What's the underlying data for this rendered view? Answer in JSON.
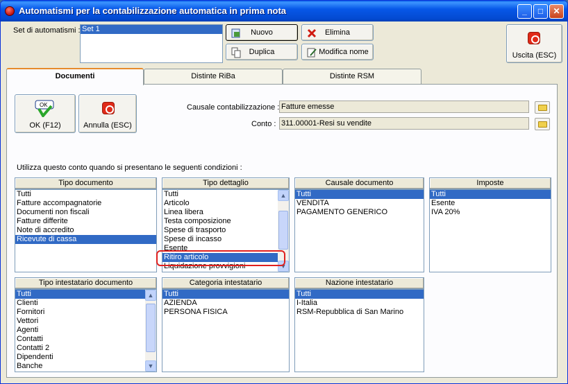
{
  "window": {
    "title": "Automatismi per la contabilizzazione automatica in prima nota",
    "minimize": "_",
    "maximize": "□",
    "close": "✕"
  },
  "set": {
    "label": "Set di automatismi :",
    "items": [
      "Set 1"
    ],
    "selected": "Set 1"
  },
  "toolbar": {
    "nuovo": "Nuovo",
    "elimina": "Elimina",
    "duplica": "Duplica",
    "modifica_nome": "Modifica nome",
    "uscita": "Uscita (ESC)"
  },
  "tabs": [
    {
      "label": "Documenti",
      "active": true
    },
    {
      "label": "Distinte RiBa",
      "active": false
    },
    {
      "label": "Distinte RSM",
      "active": false
    }
  ],
  "actions": {
    "ok": "OK (F12)",
    "annulla": "Annulla (ESC)",
    "ok_icon_text": "OK"
  },
  "fields": {
    "causale_label": "Causale contabilizzazione :",
    "causale_value": "Fatture emesse",
    "conto_label": "Conto :",
    "conto_value": "311.00001-Resi su vendite"
  },
  "conditions_label": "Utilizza questo conto quando si presentano le seguenti condizioni :",
  "groups": {
    "tipo_documento": {
      "header": "Tipo documento",
      "items": [
        "Tutti",
        "Fatture accompagnatorie",
        "Documenti non fiscali",
        "Fatture differite",
        "Note di accredito",
        "Ricevute di cassa"
      ],
      "selected_index": 5
    },
    "tipo_dettaglio": {
      "header": "Tipo dettaglio",
      "items": [
        "Tutti",
        "Articolo",
        "Linea libera",
        "Testa composizione",
        "Spese di trasporto",
        "Spese di incasso",
        "Esente",
        "Ritiro articolo",
        "Liquidazione provvigioni"
      ],
      "selected_index": 7
    },
    "causale_documento": {
      "header": "Causale documento",
      "items": [
        "Tutti",
        "VENDITA",
        "PAGAMENTO GENERICO"
      ],
      "selected_index": 0
    },
    "imposte": {
      "header": "Imposte",
      "items": [
        "Tutti",
        "Esente",
        "IVA 20%"
      ],
      "selected_index": 0
    },
    "tipo_intestatario": {
      "header": "Tipo intestatario documento",
      "items": [
        "Tutti",
        "Clienti",
        "Fornitori",
        "Vettori",
        "Agenti",
        "Contatti",
        "Contatti 2",
        "Dipendenti",
        "Banche"
      ],
      "selected_index": 0
    },
    "categoria_intestatario": {
      "header": "Categoria intestatario",
      "items": [
        "Tutti",
        "AZIENDA",
        "PERSONA FISICA"
      ],
      "selected_index": 0
    },
    "nazione_intestatario": {
      "header": "Nazione intestatario",
      "items": [
        "Tutti",
        "I-Italia",
        "RSM-Repubblica di San Marino"
      ],
      "selected_index": 0
    }
  },
  "scroll_arrows": {
    "up": "▲",
    "down": "▼"
  },
  "colors": {
    "selection": "#316ac5",
    "highlight_ring": "#e0201e",
    "titlebar": "#0758e8"
  }
}
